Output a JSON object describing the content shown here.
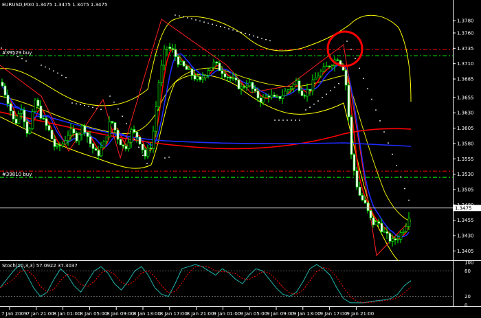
{
  "header": {
    "symbol_info": "EURUSD,M30  1.3475 1.3475 1.3475 1.3475"
  },
  "orders": [
    {
      "label": "#39529 buy",
      "price": 1.3733
    },
    {
      "label": "#39810 buy",
      "price": 1.3535
    }
  ],
  "current_price": "1.3475",
  "stoch_header": "Stoch(10,3,3) 57.0922 37.3037",
  "colors": {
    "background": "#000000",
    "axis": "#ffffff",
    "bull_candle": "#ffffff",
    "bear_candle": "#00ff00",
    "bollinger": "#ffff00",
    "ma_red": "#ff0000",
    "ma_blue": "#1f2bff",
    "order_red": "#ff0000",
    "order_green": "#00ff00",
    "stoch_main": "#20b2aa",
    "stoch_signal": "#ff0000",
    "highlight_circle": "#ff0000"
  },
  "chart_data": {
    "type": "candlestick",
    "price_ticks": [
      "1.3780",
      "1.3760",
      "1.3735",
      "1.3710",
      "1.3685",
      "1.3655",
      "1.3630",
      "1.3605",
      "1.3580",
      "1.3555",
      "1.3530",
      "1.3505",
      "1.3480",
      "1.3455",
      "1.3430",
      "1.3405"
    ],
    "ylim": [
      1.3392,
      1.3798
    ],
    "time_labels": [
      "7 Jan 2009",
      "7 Jan 21:00",
      "8 Jan 01:00",
      "8 Jan 05:00",
      "8 Jan 09:00",
      "8 Jan 13:00",
      "8 Jan 17:00",
      "8 Jan 21:00",
      "9 Jan 01:00",
      "9 Jan 05:00",
      "9 Jan 09:00",
      "9 Jan 13:00",
      "9 Jan 17:00",
      "9 Jan 21:00"
    ],
    "stoch_ticks": [
      "100",
      "80",
      "20",
      "0"
    ],
    "stoch_ylim": [
      0,
      100
    ]
  }
}
